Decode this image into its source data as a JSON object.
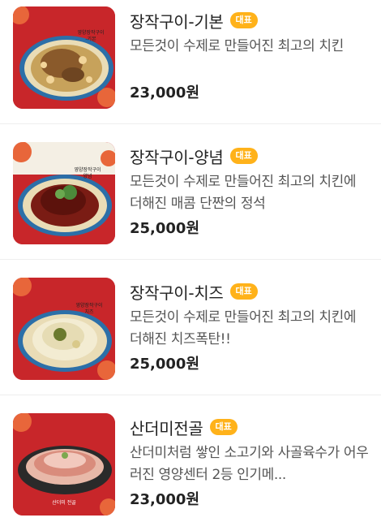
{
  "menu": {
    "items": [
      {
        "name": "장작구이-기본",
        "badge": "대표",
        "description": "모든것이 수제로 만들어진 최고의 치킨",
        "price": "23,000원",
        "image_label": "영양장작구이 -기본",
        "image_icon": "roast-chicken-plate-icon"
      },
      {
        "name": "장작구이-양념",
        "badge": "대표",
        "description": "모든것이 수제로 만들어진 최고의 치킨에 더해진 매콤 단짠의 정석",
        "price": "25,000원",
        "image_label": "영양장작구이 양념",
        "image_icon": "spicy-chicken-plate-icon"
      },
      {
        "name": "장작구이-치즈",
        "badge": "대표",
        "description": "모든것이 수제로 만들어진 최고의 치킨에 더해진 치즈폭탄!!",
        "price": "25,000원",
        "image_label": "영양장작구이 치즈",
        "image_icon": "cheese-chicken-plate-icon"
      },
      {
        "name": "산더미전골",
        "badge": "대표",
        "description": "산더미처럼 쌓인 소고기와 사골육수가 어우러진 영양센터 2등 인기메...",
        "price": "23,000원",
        "image_label": "산더미 전골",
        "image_icon": "hotpot-icon"
      }
    ]
  },
  "colors": {
    "badge": "#ffb21a",
    "thumb_bg": "#c8262a",
    "divider": "#eeeeee"
  }
}
